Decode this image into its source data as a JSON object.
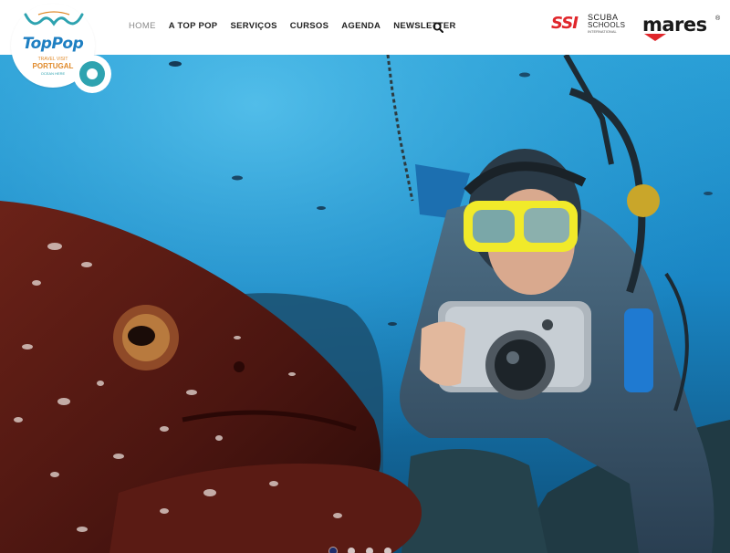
{
  "brand": {
    "wordmark": "TopPop",
    "tagline_small": "TRAVEL VISIT",
    "tagline_country": "PORTUGAL",
    "tagline_sub": "OCEAN HERE",
    "accent_color": "#2ea3b0",
    "logo_blue": "#1e7fc2",
    "logo_orange": "#e08a2a"
  },
  "nav": {
    "items": [
      {
        "label": "HOME",
        "active": true
      },
      {
        "label": "A TOP POP",
        "active": false
      },
      {
        "label": "SERVIÇOS",
        "active": false
      },
      {
        "label": "CURSOS",
        "active": false
      },
      {
        "label": "AGENDA",
        "active": false
      },
      {
        "label": "NEWSLETTER",
        "active": false
      }
    ],
    "search_icon": "search-icon"
  },
  "partners": {
    "ssi": {
      "mark": "SSI",
      "line1": "SCUBA",
      "line2": "SCHOOLS",
      "line3": "INTERNATIONAL",
      "color": "#e0262b"
    },
    "mares": {
      "name": "mares",
      "reg": "®",
      "swoosh_color": "#e0262b"
    }
  },
  "hero": {
    "image": "underwater-diver-with-camera-and-grouper",
    "slides_total": 4,
    "active_slide": 1
  }
}
